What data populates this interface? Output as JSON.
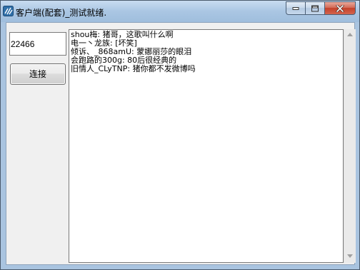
{
  "window": {
    "title": "客户端(配套)_测试就绪."
  },
  "caption_buttons": {
    "minimize_icon": "minimize-icon",
    "maximize_icon": "maximize-icon",
    "close_icon": "close-icon"
  },
  "form": {
    "port_value": "22466",
    "connect_label": "连接"
  },
  "chat": {
    "lines": [
      "shou梅:   猪哥，这歌叫什么啊",
      "电一丶龙族:  [坏笑]",
      "倾诉、_868amU:  蒙娜丽莎的眼泪",
      "会跑路的300g:  80后很经典的",
      "旧情人_CLyTNP:  猪你都不发微博吗"
    ]
  },
  "colors": {
    "title_bar": "#aac6e3",
    "close_button": "#c4412a",
    "client_background": "#f0f0f0"
  }
}
